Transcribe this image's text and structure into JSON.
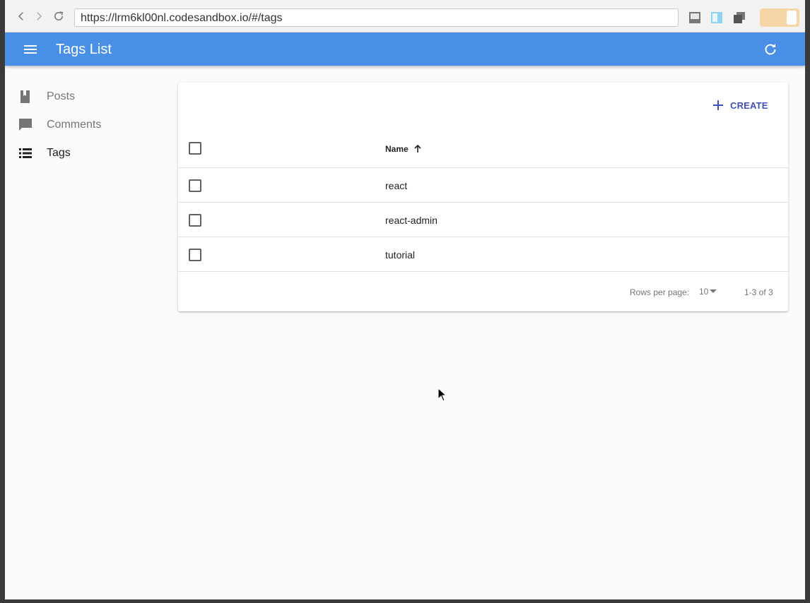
{
  "browser": {
    "url": "https://lrm6kl00nl.codesandbox.io/#/tags"
  },
  "app_bar": {
    "title": "Tags List"
  },
  "sidebar": {
    "items": [
      {
        "label": "Posts",
        "icon": "book-icon"
      },
      {
        "label": "Comments",
        "icon": "chat-bubble-icon"
      },
      {
        "label": "Tags",
        "icon": "list-icon",
        "active": true
      }
    ]
  },
  "list": {
    "create_label": "CREATE",
    "column_name": "Name",
    "rows": [
      {
        "name": "react"
      },
      {
        "name": "react-admin"
      },
      {
        "name": "tutorial"
      }
    ]
  },
  "pagination": {
    "rows_per_page_label": "Rows per page:",
    "rows_per_page_value": "10",
    "range": "1-3 of 3"
  },
  "colors": {
    "app_bar": "#4a8fe6",
    "primary_button": "#3f51b5"
  }
}
